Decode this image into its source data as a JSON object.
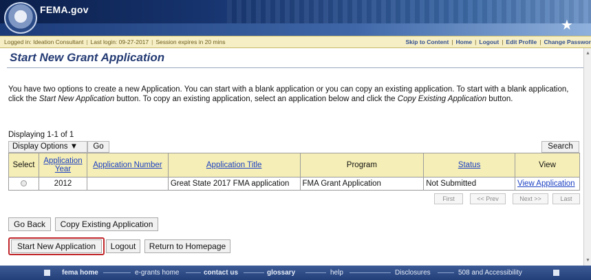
{
  "header": {
    "brand": "FEMA.gov"
  },
  "infobar": {
    "logged_in": "Logged in: Ideation Consultant",
    "last_login": "Last login: 09-27-2017",
    "session": "Session expires in 20 mins",
    "links": [
      "Skip to Content",
      "Home",
      "Logout",
      "Edit Profile",
      "Change Passwor"
    ]
  },
  "page": {
    "title": "Start New Grant Application",
    "intro": {
      "p1": "You have two options to create a new Application. You can start with a blank application or you can copy an existing application. To start with a blank application, click the ",
      "em1": "Start New Application",
      "p2": " button. To copy an existing application, select an application below and click the ",
      "em2": "Copy Existing Application",
      "p3": " button."
    },
    "displaying": "Displaying 1-1 of 1"
  },
  "controls": {
    "display_options": "Display Options ▼",
    "go": "Go",
    "search": "Search"
  },
  "table": {
    "headers": {
      "select": "Select",
      "year": "Application Year",
      "number": "Application Number",
      "title": "Application Title",
      "program": "Program",
      "status": "Status",
      "view": "View"
    },
    "rows": [
      {
        "year": "2012",
        "number": "",
        "title": "Great State 2017 FMA application",
        "program": "FMA Grant Application",
        "status": "Not Submitted",
        "view": "View Application"
      }
    ]
  },
  "pager": {
    "first": "First",
    "prev": "<< Prev",
    "next": "Next >>",
    "last": "Last"
  },
  "buttons": {
    "go_back": "Go Back",
    "copy_existing": "Copy Existing Application",
    "start_new": "Start New Application",
    "logout": "Logout",
    "return_home": "Return to Homepage"
  },
  "footer": {
    "links": [
      "fema home",
      "e-grants home",
      "contact us",
      "glossary",
      "help",
      "Disclosures",
      "508 and Accessibility"
    ]
  }
}
